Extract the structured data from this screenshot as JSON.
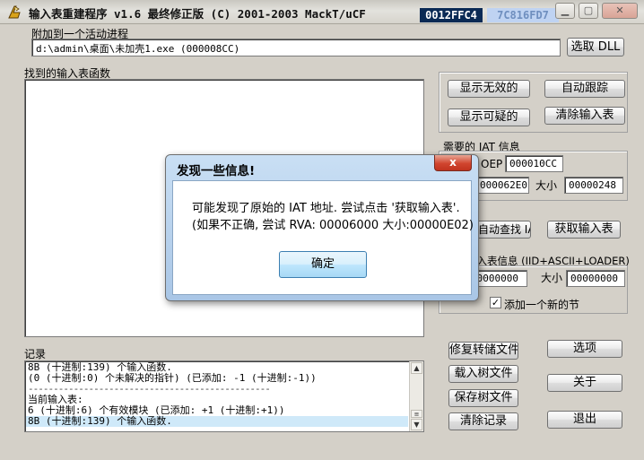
{
  "window": {
    "title": "输入表重建程序 v1.6 最终修正版 (C) 2001-2003 MackT/uCF",
    "hex_primary": "0012FFC4",
    "hex_secondary": "7C816FD7"
  },
  "process": {
    "group_label": "附加到一个活动进程",
    "value": "d:\\admin\\桌面\\未加壳1.exe (000008CC)",
    "select_dll": "选取 DLL"
  },
  "imports": {
    "group_label": "找到的输入表函数"
  },
  "buttons": {
    "show_invalid": "显示无效的",
    "auto_trace": "自动跟踪",
    "show_suspect": "显示可疑的",
    "clear_imports": "清除输入表",
    "iat_autosearch": "IAT 自动查找 IAT",
    "get_imports": "获取输入表",
    "restore_dump": "修复转储文件",
    "load_tree": "载入树文件",
    "save_tree": "保存树文件",
    "clear_log": "清除记录",
    "options": "选项",
    "about": "关于",
    "exit": "退出"
  },
  "iat": {
    "group_label": "需要的 IAT 信息",
    "oep_label": "OEP",
    "oep_value": "000010CC",
    "rva_value": "000062E0",
    "size_label": "大小",
    "size_value": "00000248"
  },
  "loader": {
    "group_label": "输入表信息 (IID+ASCII+LOADER)",
    "rva_value": "00000000",
    "size_label": "大小",
    "size_value": "00000000",
    "add_section": "添加一个新的节",
    "add_section_checked": true
  },
  "log": {
    "label": "记录",
    "lines": [
      "8B (十进制:139) 个输入函数.",
      "(0 (十进制:0) 个未解决的指针) (已添加: -1 (十进制:-1))",
      "------------------------------------------------",
      "当前输入表:",
      "6 (十进制:6) 个有效模块 (已添加: +1 (十进制:+1))",
      "8B (十进制:139) 个输入函数."
    ]
  },
  "dialog": {
    "title": "发现一些信息!",
    "close": "x",
    "line1": "可能发现了原始的 IAT 地址. 尝试点击 '获取输入表'.",
    "line2": "(如果不正确, 尝试 RVA: 00006000 大小:00000E02)",
    "ok": "确定"
  }
}
